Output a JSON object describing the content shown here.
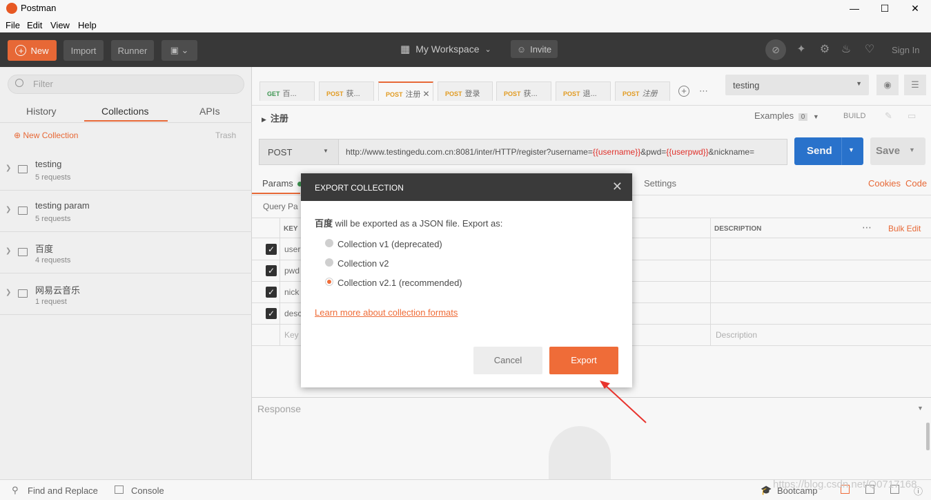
{
  "app": {
    "title": "Postman"
  },
  "menu": [
    "File",
    "Edit",
    "View",
    "Help"
  ],
  "toolbar": {
    "new_label": "New",
    "import_label": "Import",
    "runner_label": "Runner",
    "workspace_label": "My Workspace",
    "invite_label": "Invite",
    "signin_label": "Sign In"
  },
  "sidebar": {
    "filter_placeholder": "Filter",
    "tabs": [
      "History",
      "Collections",
      "APIs"
    ],
    "new_collection": "New Collection",
    "trash": "Trash",
    "collections": [
      {
        "name": "testing",
        "requests": "5 requests"
      },
      {
        "name": "testing param",
        "requests": "5 requests"
      },
      {
        "name": "百度",
        "requests": "4 requests"
      },
      {
        "name": "网易云音乐",
        "requests": "1 request"
      }
    ]
  },
  "tabs": [
    {
      "method": "GET",
      "label": "百..."
    },
    {
      "method": "POST",
      "label": "获..."
    },
    {
      "method": "POST",
      "label": "注册"
    },
    {
      "method": "POST",
      "label": "登录"
    },
    {
      "method": "POST",
      "label": "获..."
    },
    {
      "method": "POST",
      "label": "退..."
    },
    {
      "method": "POST",
      "label": "注册"
    }
  ],
  "environment": "testing",
  "request": {
    "name": "注册",
    "examples_label": "Examples",
    "examples_count": "0",
    "build_label": "BUILD",
    "method": "POST",
    "url_prefix": "http://www.testingedu.com.cn:8081/inter/HTTP/register?username=",
    "url_var1": "{{username}}",
    "url_mid": "&pwd=",
    "url_var2": "{{userpwd}}",
    "url_suffix": "&nickname=",
    "send_label": "Send",
    "save_label": "Save",
    "params_label": "Params",
    "settings_label": "Settings",
    "cookies_label": "Cookies",
    "code_label": "Code",
    "query_params_label": "Query Pa",
    "key_header": "KEY",
    "description_header": "DESCRIPTION",
    "bulk_edit": "Bulk Edit",
    "params": [
      "user",
      "pwd",
      "nick",
      "desc"
    ],
    "key_placeholder": "Key",
    "description_placeholder": "Description",
    "response_label": "Response"
  },
  "modal": {
    "title": "EXPORT COLLECTION",
    "collection_name": "百度",
    "message": " will be exported as a JSON file. Export as:",
    "options": [
      "Collection v1 (deprecated)",
      "Collection v2",
      "Collection v2.1 (recommended)"
    ],
    "selected_index": 2,
    "learn_more": "Learn more about collection formats",
    "cancel_label": "Cancel",
    "export_label": "Export"
  },
  "footer": {
    "find_replace": "Find and Replace",
    "console": "Console",
    "bootcamp": "Bootcamp"
  },
  "watermark": "https://blog.csdn.net/Q0717168",
  "colors": {
    "accent": "#ef6c38",
    "send": "#2b76d2",
    "toolbar": "#3a3a3a",
    "arrow": "#e8332d"
  }
}
